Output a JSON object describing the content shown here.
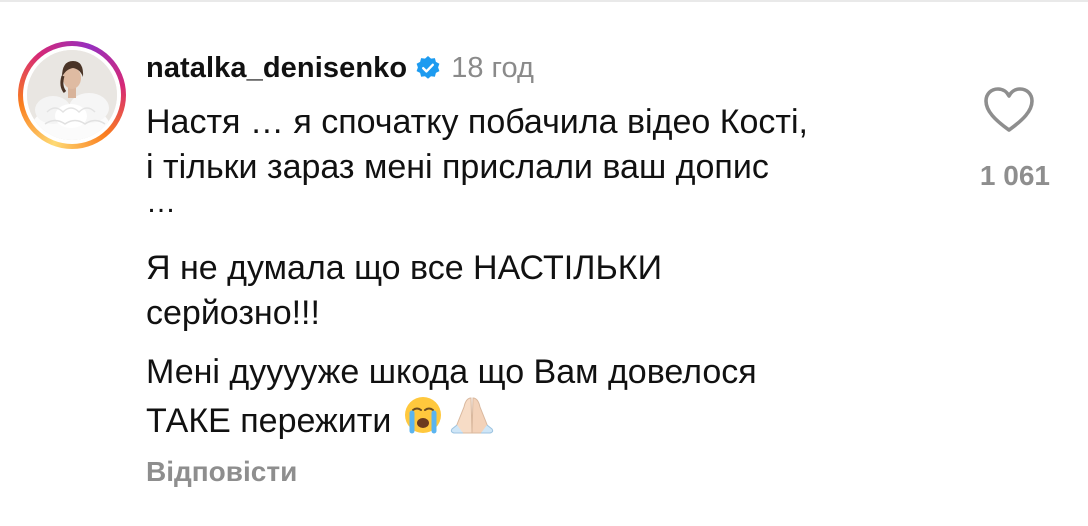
{
  "comment": {
    "username": "natalka_denisenko",
    "verified_icon": "verified-badge-icon",
    "time": "18 год",
    "paragraphs": [
      [
        "Настя … я спочатку побачила відео Кості,",
        "і тільки зараз мені прислали ваш допис",
        "…"
      ],
      [
        "Я не думала що все НАСТІЛЬКИ",
        "серйозно!!!"
      ],
      [
        "Мені дууууже шкода що Вам довелося",
        "ТАКЕ пережити"
      ]
    ],
    "emojis": [
      "crying-face-emoji",
      "folded-hands-emoji"
    ],
    "reply_label": "Відповісти",
    "like_icon": "heart-icon",
    "like_count": "1 061"
  },
  "colors": {
    "text": "#111111",
    "muted": "#8e8e8e",
    "verified": "#1d9bf0",
    "divider": "#e9e9e9"
  }
}
